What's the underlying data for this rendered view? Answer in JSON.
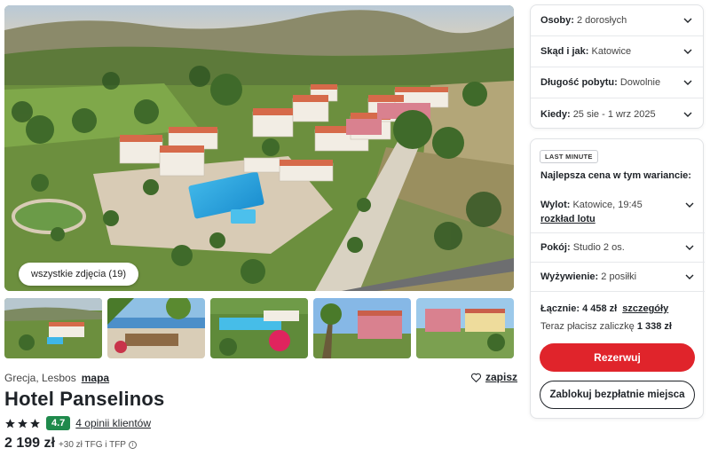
{
  "gallery": {
    "all_photos_label": "wszystkie zdjęcia (19)"
  },
  "hotel": {
    "location": "Grecja, Lesbos",
    "map_label": "mapa",
    "save_label": "zapisz",
    "name": "Hotel Panselinos",
    "stars": 3,
    "score": "4.7",
    "reviews_label": "4 opinii klientów",
    "price": "2 199 zł",
    "price_extra": "+30 zł TFG i TFP",
    "info_glyph": "i"
  },
  "search": {
    "rows": [
      {
        "label": "Osoby:",
        "value": "2 dorosłych"
      },
      {
        "label": "Skąd i jak:",
        "value": "Katowice"
      },
      {
        "label": "Długość pobytu:",
        "value": "Dowolnie"
      },
      {
        "label": "Kiedy:",
        "value": "25 sie - 1 wrz 2025"
      }
    ]
  },
  "offer": {
    "badge": "LAST MINUTE",
    "best_price": "Najlepsza cena w tym wariancie:",
    "flight_label": "Wylot:",
    "flight_value": "Katowice, 19:45",
    "flight_link": "rozkład lotu",
    "room_label": "Pokój:",
    "room_value": "Studio 2 os.",
    "board_label": "Wyżywienie:",
    "board_value": "2 posiłki",
    "total_label": "Łącznie: 4 458 zł",
    "details_link": "szczegóły",
    "deposit_text": "Teraz płacisz zaliczkę",
    "deposit_value": "1 338 zł",
    "reserve_button": "Rezerwuj",
    "block_button": "Zablokuj bezpłatnie miejsca"
  },
  "colors": {
    "accent_red": "#e0242b",
    "score_green": "#1f8a4c",
    "text_dark": "#1f2328"
  },
  "icons": [
    "heart-icon",
    "star-icon",
    "chevron-down-icon",
    "info-icon"
  ]
}
